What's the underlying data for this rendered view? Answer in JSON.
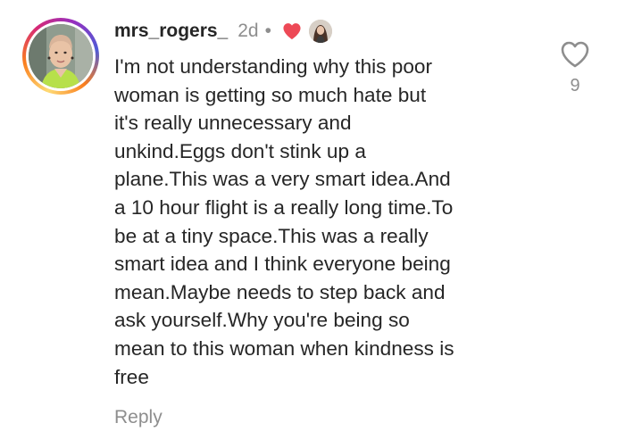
{
  "comment": {
    "username": "mrs_rogers_",
    "time": "2d",
    "separator": "•",
    "text": "I'm not understanding why this poor\nwoman is getting so much hate but\nit's really unnecessary and\nunkind.Eggs don't stink up a\nplane.This was a very smart idea.And\na 10 hour flight is a really long time.To\nbe at a tiny space.This was a really\nsmart idea and I think everyone being\nmean.Maybe needs to step back and\nask yourself.Why you're being so\nmean to this woman when kindness is\nfree",
    "reply_label": "Reply",
    "like_count": "9",
    "icons": {
      "creator_heart": "red-heart-icon",
      "like": "heart-outline-icon"
    },
    "colors": {
      "text": "#262626",
      "muted": "#8e8e8e",
      "creator_heart": "#ed4956"
    }
  }
}
